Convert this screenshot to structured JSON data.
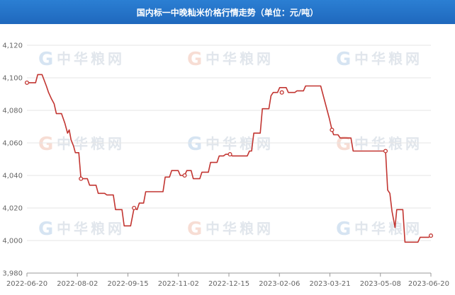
{
  "chart_data": {
    "type": "line",
    "title": "国内标一中晚籼米价格行情走势（单位：元/吨）",
    "xlabel": "",
    "ylabel": "",
    "ylim": [
      3980,
      4120
    ],
    "yticks": [
      3980,
      4000,
      4020,
      4040,
      4060,
      4080,
      4100,
      4120
    ],
    "yticks_labels": [
      "3,980",
      "4,000",
      "4,020",
      "4,040",
      "4,060",
      "4,080",
      "4,100",
      "4,120"
    ],
    "xticks": [
      "2022-06-20",
      "2022-08-02",
      "2022-09-15",
      "2022-11-02",
      "2022-12-15",
      "2023-02-06",
      "2023-03-21",
      "2023-05-08",
      "2023-06-20"
    ],
    "grid": true,
    "line_color": "#c23531",
    "watermark": "中华粮网",
    "series": [
      {
        "name": "",
        "points": [
          [
            0.0,
            4097
          ],
          [
            2.0,
            4097
          ],
          [
            2.5,
            4102
          ],
          [
            3.5,
            4102
          ],
          [
            4.5,
            4095
          ],
          [
            5.0,
            4091
          ],
          [
            5.7,
            4087
          ],
          [
            6.3,
            4084
          ],
          [
            6.8,
            4078
          ],
          [
            8.0,
            4078
          ],
          [
            8.8,
            4072
          ],
          [
            9.4,
            4066
          ],
          [
            9.8,
            4068
          ],
          [
            10.2,
            4062
          ],
          [
            10.8,
            4058
          ],
          [
            11.2,
            4054
          ],
          [
            12.0,
            4054
          ],
          [
            12.5,
            4038
          ],
          [
            14.0,
            4038
          ],
          [
            14.5,
            4034
          ],
          [
            16.0,
            4034
          ],
          [
            16.5,
            4029
          ],
          [
            18.0,
            4029
          ],
          [
            18.5,
            4028
          ],
          [
            20.0,
            4028
          ],
          [
            20.5,
            4019
          ],
          [
            22.0,
            4019
          ],
          [
            22.5,
            4009
          ],
          [
            24.0,
            4009
          ],
          [
            24.8,
            4020
          ],
          [
            25.5,
            4019
          ],
          [
            26.0,
            4023
          ],
          [
            27.0,
            4023
          ],
          [
            27.5,
            4030
          ],
          [
            31.5,
            4030
          ],
          [
            32.0,
            4039
          ],
          [
            33.0,
            4039
          ],
          [
            33.5,
            4043
          ],
          [
            35.0,
            4043
          ],
          [
            35.5,
            4040
          ],
          [
            36.5,
            4040
          ],
          [
            37.0,
            4043
          ],
          [
            38.0,
            4043
          ],
          [
            38.5,
            4038
          ],
          [
            40.0,
            4038
          ],
          [
            40.5,
            4042
          ],
          [
            42.0,
            4042
          ],
          [
            42.5,
            4048
          ],
          [
            44.0,
            4048
          ],
          [
            44.5,
            4052
          ],
          [
            45.5,
            4052
          ],
          [
            46.0,
            4053
          ],
          [
            47.0,
            4053
          ],
          [
            47.5,
            4052
          ],
          [
            51.0,
            4052
          ],
          [
            51.5,
            4055
          ],
          [
            52.0,
            4055
          ],
          [
            52.5,
            4066
          ],
          [
            54.0,
            4066
          ],
          [
            54.5,
            4081
          ],
          [
            56.0,
            4081
          ],
          [
            56.5,
            4089
          ],
          [
            57.0,
            4091
          ],
          [
            58.0,
            4091
          ],
          [
            58.5,
            4094
          ],
          [
            60.0,
            4094
          ],
          [
            60.5,
            4091
          ],
          [
            62.0,
            4091
          ],
          [
            62.5,
            4092
          ],
          [
            64.0,
            4092
          ],
          [
            64.5,
            4095
          ],
          [
            68.0,
            4095
          ],
          [
            69.0,
            4085
          ],
          [
            70.0,
            4075
          ],
          [
            70.6,
            4068
          ],
          [
            71.0,
            4065
          ],
          [
            72.0,
            4065
          ],
          [
            72.5,
            4063
          ],
          [
            75.0,
            4063
          ],
          [
            75.5,
            4055
          ],
          [
            78.0,
            4055
          ],
          [
            82.0,
            4055
          ],
          [
            83.0,
            4055
          ],
          [
            83.5,
            4031
          ],
          [
            84.0,
            4029
          ],
          [
            84.5,
            4018
          ],
          [
            85.2,
            4008
          ],
          [
            85.6,
            4019
          ],
          [
            87.0,
            4019
          ],
          [
            87.5,
            3999
          ],
          [
            90.0,
            3999
          ],
          [
            90.5,
            3999
          ],
          [
            91.0,
            4002
          ],
          [
            92.0,
            4002
          ],
          [
            93.0,
            4002
          ],
          [
            93.5,
            4003
          ]
        ],
        "markers": [
          [
            0.0,
            4097
          ],
          [
            12.5,
            4038
          ],
          [
            24.8,
            4020
          ],
          [
            36.5,
            4040
          ],
          [
            47.0,
            4053
          ],
          [
            59.0,
            4091
          ],
          [
            70.6,
            4068
          ],
          [
            83.0,
            4055
          ],
          [
            93.5,
            4003
          ]
        ]
      }
    ]
  }
}
